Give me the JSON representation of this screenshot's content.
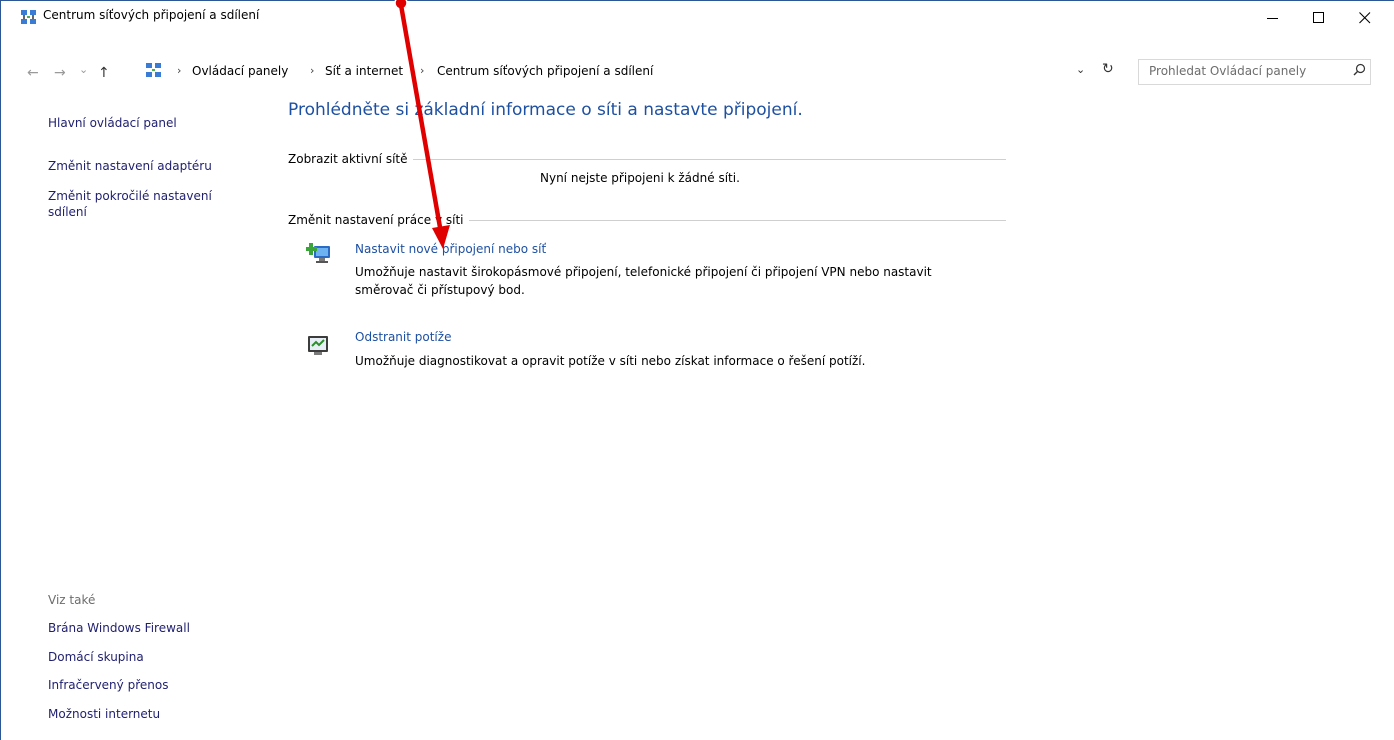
{
  "window": {
    "title": "Centrum síťových připojení a sdílení",
    "minimize_glyph": "—",
    "maximize_glyph": "☐",
    "close_glyph": "✕"
  },
  "address_bar": {
    "back_glyph": "←",
    "forward_glyph": "→",
    "history_glyph": "⌄",
    "up_glyph": "↑",
    "breadcrumbs": [
      "Ovládací panely",
      "Síť a internet",
      "Centrum síťových připojení a sdílení"
    ],
    "separator": "›",
    "dropdown_glyph": "⌄",
    "refresh_glyph": "↻"
  },
  "search": {
    "placeholder": "Prohledat Ovládací panely"
  },
  "left_pane": {
    "links": [
      "Hlavní ovládací panel",
      "Změnit nastavení adaptéru",
      "Změnit pokročilé nastavení",
      "sdílení"
    ],
    "see_also_title": "Viz také",
    "see_also": [
      "Brána Windows Firewall",
      "Domácí skupina",
      "Infračervený přenos",
      "Možnosti internetu"
    ]
  },
  "main": {
    "heading": "Prohlédněte si základní informace o síti a nastavte připojení.",
    "active_networks": {
      "title": "Zobrazit aktivní sítě",
      "empty_message": "Nyní nejste připojeni k žádné síti."
    },
    "change_settings": {
      "title": "Změnit nastavení práce v síti",
      "tasks": [
        {
          "icon": "new-connection-icon",
          "link": "Nastavit nové připojení nebo síť",
          "description_line1": "Umožňuje nastavit širokopásmové připojení, telefonické připojení či připojení VPN nebo nastavit",
          "description_line2": "směrovač či přístupový bod."
        },
        {
          "icon": "troubleshoot-icon",
          "link": "Odstranit potíže",
          "description_line1": "Umožňuje diagnostikovat a opravit potíže v síti nebo získat informace o řešení potíží."
        }
      ]
    }
  },
  "colors": {
    "heading_blue": "#1e50a2",
    "link_blue": "#1e50a2",
    "annotation_red": "#e00000"
  }
}
